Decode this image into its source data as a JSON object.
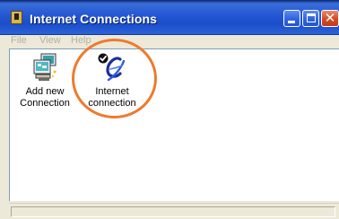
{
  "window": {
    "title": "Internet Connections",
    "icon": "folder-icon",
    "controls": {
      "minimize_icon": "minimize-icon",
      "maximize_icon": "maximize-icon",
      "close_icon": "close-icon",
      "close_glyph": "✕"
    },
    "colors": {
      "titlebar": "#2356d4",
      "close_button": "#d24b25",
      "highlight": "#ee7a2e"
    }
  },
  "menu": {
    "items": [
      {
        "label": "File"
      },
      {
        "label": "View"
      },
      {
        "label": "Help"
      }
    ]
  },
  "content": {
    "items": [
      {
        "label_line1": "Add new",
        "label_line2": "Connection",
        "icon": "new-connection-wizard-icon"
      },
      {
        "label_line1": "Internet",
        "label_line2": "connection",
        "icon": "internet-connection-icon",
        "default": true,
        "badge_icon": "default-checkmark-icon",
        "highlighted": true
      }
    ]
  }
}
